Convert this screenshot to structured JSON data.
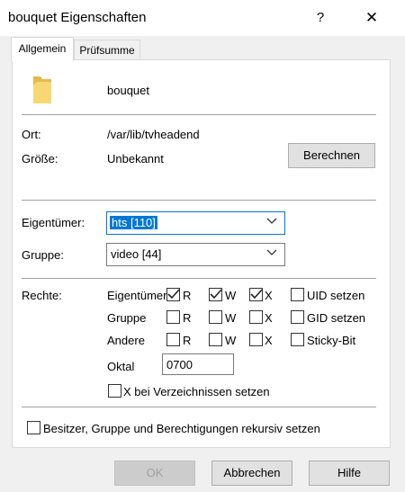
{
  "window": {
    "title": "bouquet Eigenschaften",
    "help": "?",
    "close": "✕"
  },
  "tabs": [
    {
      "label": "Allgemein",
      "active": true
    },
    {
      "label": "Prüfsumme",
      "active": false
    }
  ],
  "general": {
    "folder_name": "bouquet",
    "ort_label": "Ort:",
    "ort_value": "/var/lib/tvheadend",
    "size_label": "Größe:",
    "size_value": "Unbekannt",
    "calculate_button": "Berechnen",
    "owner_label": "Eigentümer:",
    "owner_value": "hts [110]",
    "group_label": "Gruppe:",
    "group_value": "video [44]",
    "rights_label": "Rechte:"
  },
  "permissions": {
    "rows": [
      {
        "label": "Eigentümer",
        "r": true,
        "w": true,
        "x": true,
        "extra_label": "UID setzen",
        "extra": false
      },
      {
        "label": "Gruppe",
        "r": false,
        "w": false,
        "x": false,
        "extra_label": "GID setzen",
        "extra": false
      },
      {
        "label": "Andere",
        "r": false,
        "w": false,
        "x": false,
        "extra_label": "Sticky-Bit",
        "extra": false
      }
    ],
    "r_label": "R",
    "w_label": "W",
    "x_label": "X",
    "octal_label": "Oktal",
    "octal_value": "0700",
    "dir_x_label": "X bei Verzeichnissen setzen"
  },
  "recursive_label": "Besitzer, Gruppe und Berechtigungen rekursiv setzen",
  "footer": {
    "ok": "OK",
    "cancel": "Abbrechen",
    "help": "Hilfe"
  },
  "colors": {
    "selection": "#0078d7",
    "folder": "#f8d775",
    "folder_dark": "#e8b84a"
  }
}
